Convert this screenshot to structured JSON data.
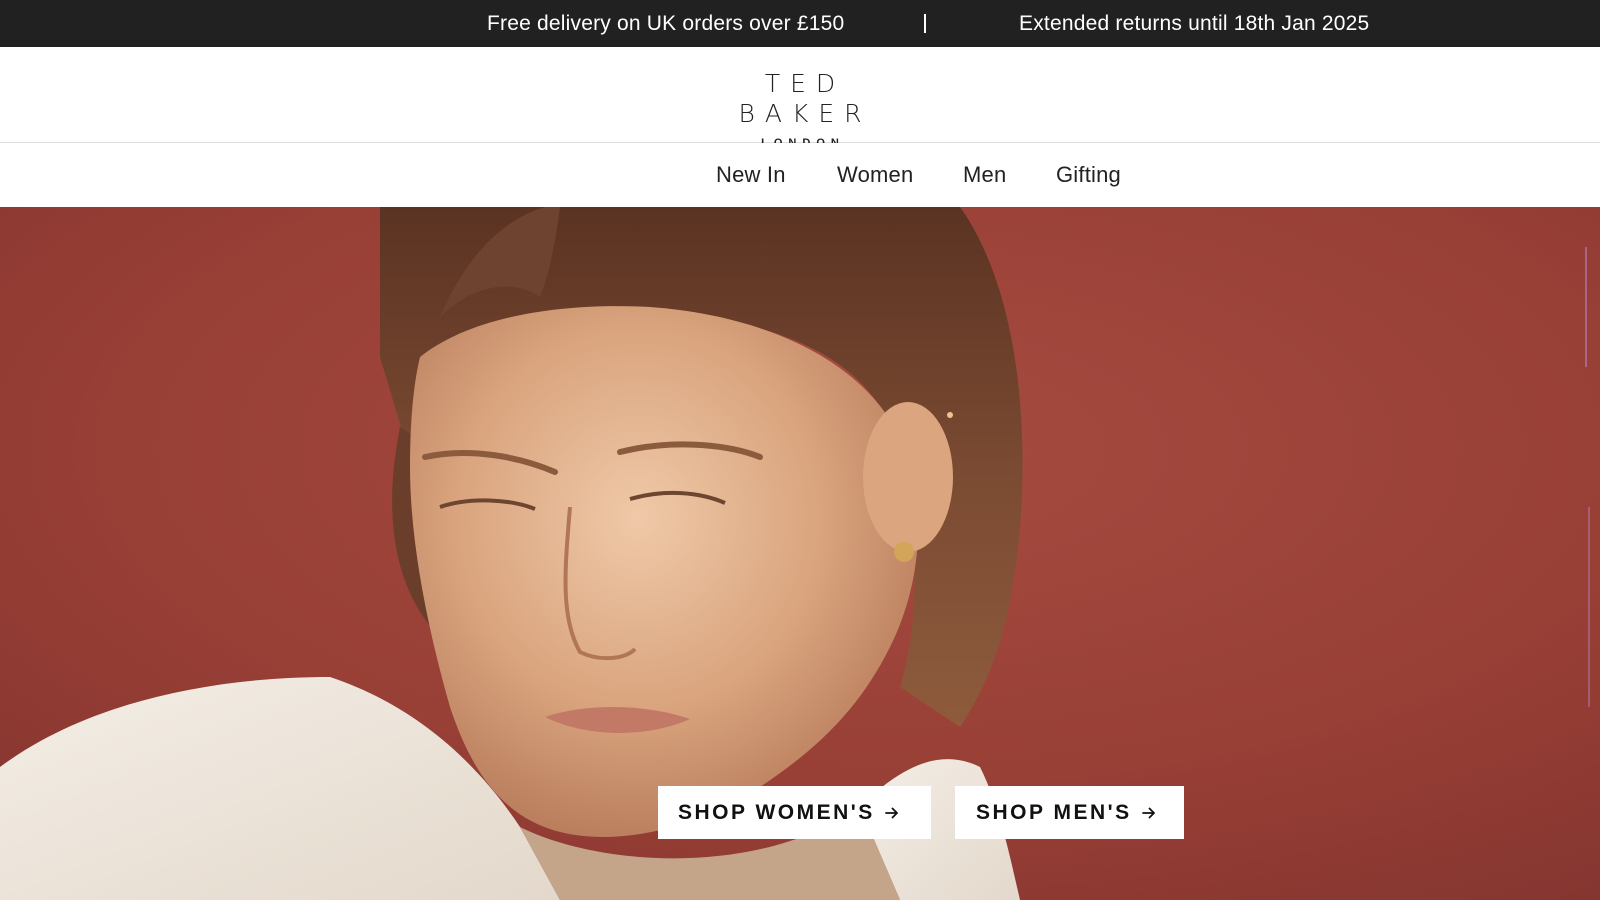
{
  "promo": {
    "left_text": "Free delivery on UK orders over £150",
    "right_text": "Extended returns until 18th Jan 2025"
  },
  "header": {
    "logo_main": "TED BAKER",
    "logo_sub": "LONDON"
  },
  "nav": {
    "items": [
      {
        "label": "New In"
      },
      {
        "label": "Women"
      },
      {
        "label": "Men"
      },
      {
        "label": "Gifting"
      }
    ]
  },
  "hero": {
    "shop_women_label": "SHOP WOMEN'S",
    "shop_men_label": "SHOP MEN'S",
    "arrow_icon": "arrow-right-icon"
  },
  "colors": {
    "promo_bg": "#212121",
    "hero_bg": "#9a4238",
    "text": "#111111"
  }
}
